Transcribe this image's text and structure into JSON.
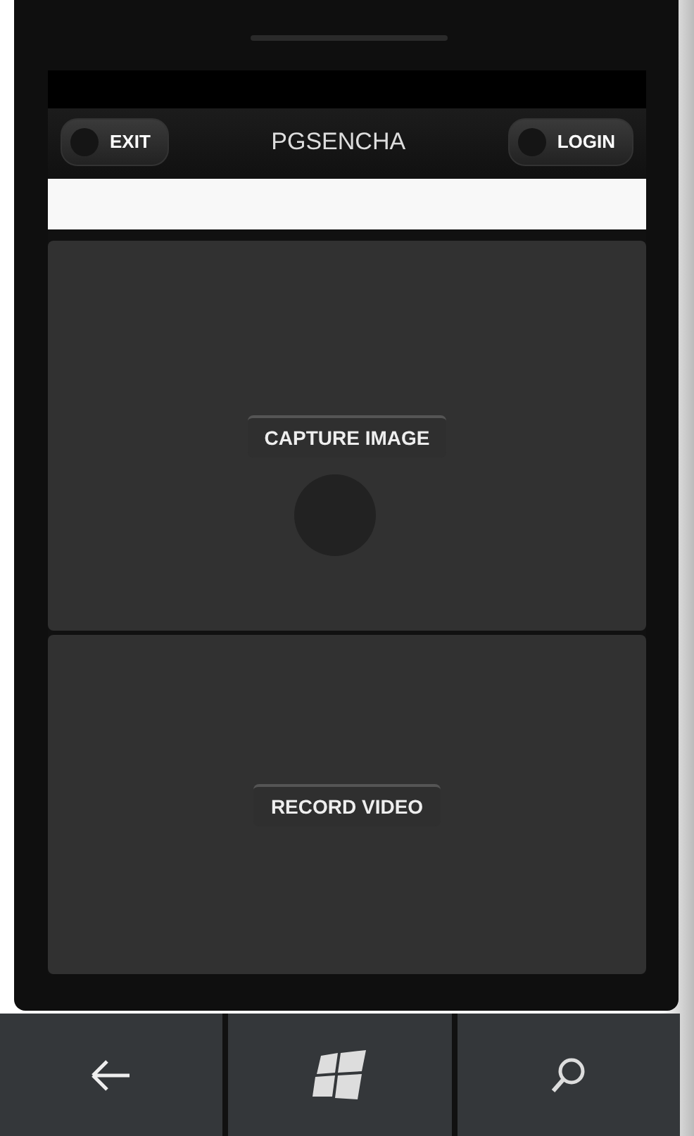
{
  "toolbar": {
    "title": "PGSENCHA",
    "buttons": [
      {
        "label": "EXIT"
      },
      {
        "label": "LOGIN"
      }
    ]
  },
  "panels": [
    {
      "label": "CAPTURE IMAGE",
      "indicator": true
    },
    {
      "label": "RECORD VIDEO",
      "indicator": false
    }
  ]
}
